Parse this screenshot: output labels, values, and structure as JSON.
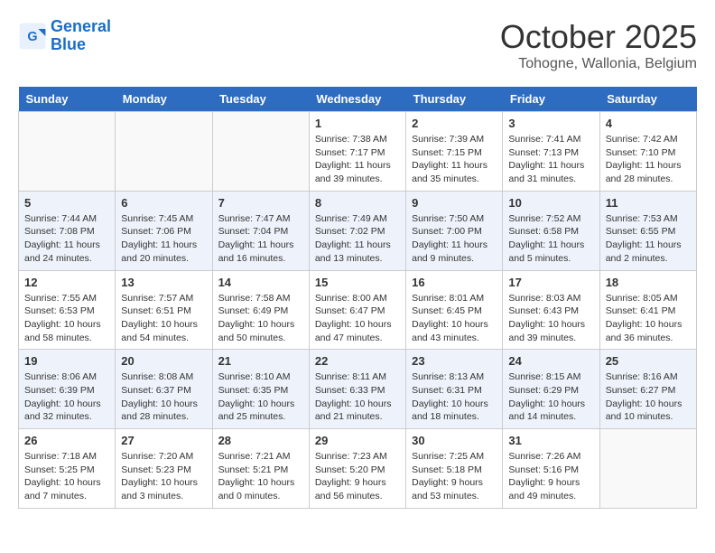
{
  "header": {
    "logo_line1": "General",
    "logo_line2": "Blue",
    "month_title": "October 2025",
    "location": "Tohogne, Wallonia, Belgium"
  },
  "weekdays": [
    "Sunday",
    "Monday",
    "Tuesday",
    "Wednesday",
    "Thursday",
    "Friday",
    "Saturday"
  ],
  "weeks": [
    [
      {
        "day": "",
        "info": ""
      },
      {
        "day": "",
        "info": ""
      },
      {
        "day": "",
        "info": ""
      },
      {
        "day": "1",
        "info": "Sunrise: 7:38 AM\nSunset: 7:17 PM\nDaylight: 11 hours\nand 39 minutes."
      },
      {
        "day": "2",
        "info": "Sunrise: 7:39 AM\nSunset: 7:15 PM\nDaylight: 11 hours\nand 35 minutes."
      },
      {
        "day": "3",
        "info": "Sunrise: 7:41 AM\nSunset: 7:13 PM\nDaylight: 11 hours\nand 31 minutes."
      },
      {
        "day": "4",
        "info": "Sunrise: 7:42 AM\nSunset: 7:10 PM\nDaylight: 11 hours\nand 28 minutes."
      }
    ],
    [
      {
        "day": "5",
        "info": "Sunrise: 7:44 AM\nSunset: 7:08 PM\nDaylight: 11 hours\nand 24 minutes."
      },
      {
        "day": "6",
        "info": "Sunrise: 7:45 AM\nSunset: 7:06 PM\nDaylight: 11 hours\nand 20 minutes."
      },
      {
        "day": "7",
        "info": "Sunrise: 7:47 AM\nSunset: 7:04 PM\nDaylight: 11 hours\nand 16 minutes."
      },
      {
        "day": "8",
        "info": "Sunrise: 7:49 AM\nSunset: 7:02 PM\nDaylight: 11 hours\nand 13 minutes."
      },
      {
        "day": "9",
        "info": "Sunrise: 7:50 AM\nSunset: 7:00 PM\nDaylight: 11 hours\nand 9 minutes."
      },
      {
        "day": "10",
        "info": "Sunrise: 7:52 AM\nSunset: 6:58 PM\nDaylight: 11 hours\nand 5 minutes."
      },
      {
        "day": "11",
        "info": "Sunrise: 7:53 AM\nSunset: 6:55 PM\nDaylight: 11 hours\nand 2 minutes."
      }
    ],
    [
      {
        "day": "12",
        "info": "Sunrise: 7:55 AM\nSunset: 6:53 PM\nDaylight: 10 hours\nand 58 minutes."
      },
      {
        "day": "13",
        "info": "Sunrise: 7:57 AM\nSunset: 6:51 PM\nDaylight: 10 hours\nand 54 minutes."
      },
      {
        "day": "14",
        "info": "Sunrise: 7:58 AM\nSunset: 6:49 PM\nDaylight: 10 hours\nand 50 minutes."
      },
      {
        "day": "15",
        "info": "Sunrise: 8:00 AM\nSunset: 6:47 PM\nDaylight: 10 hours\nand 47 minutes."
      },
      {
        "day": "16",
        "info": "Sunrise: 8:01 AM\nSunset: 6:45 PM\nDaylight: 10 hours\nand 43 minutes."
      },
      {
        "day": "17",
        "info": "Sunrise: 8:03 AM\nSunset: 6:43 PM\nDaylight: 10 hours\nand 39 minutes."
      },
      {
        "day": "18",
        "info": "Sunrise: 8:05 AM\nSunset: 6:41 PM\nDaylight: 10 hours\nand 36 minutes."
      }
    ],
    [
      {
        "day": "19",
        "info": "Sunrise: 8:06 AM\nSunset: 6:39 PM\nDaylight: 10 hours\nand 32 minutes."
      },
      {
        "day": "20",
        "info": "Sunrise: 8:08 AM\nSunset: 6:37 PM\nDaylight: 10 hours\nand 28 minutes."
      },
      {
        "day": "21",
        "info": "Sunrise: 8:10 AM\nSunset: 6:35 PM\nDaylight: 10 hours\nand 25 minutes."
      },
      {
        "day": "22",
        "info": "Sunrise: 8:11 AM\nSunset: 6:33 PM\nDaylight: 10 hours\nand 21 minutes."
      },
      {
        "day": "23",
        "info": "Sunrise: 8:13 AM\nSunset: 6:31 PM\nDaylight: 10 hours\nand 18 minutes."
      },
      {
        "day": "24",
        "info": "Sunrise: 8:15 AM\nSunset: 6:29 PM\nDaylight: 10 hours\nand 14 minutes."
      },
      {
        "day": "25",
        "info": "Sunrise: 8:16 AM\nSunset: 6:27 PM\nDaylight: 10 hours\nand 10 minutes."
      }
    ],
    [
      {
        "day": "26",
        "info": "Sunrise: 7:18 AM\nSunset: 5:25 PM\nDaylight: 10 hours\nand 7 minutes."
      },
      {
        "day": "27",
        "info": "Sunrise: 7:20 AM\nSunset: 5:23 PM\nDaylight: 10 hours\nand 3 minutes."
      },
      {
        "day": "28",
        "info": "Sunrise: 7:21 AM\nSunset: 5:21 PM\nDaylight: 10 hours\nand 0 minutes."
      },
      {
        "day": "29",
        "info": "Sunrise: 7:23 AM\nSunset: 5:20 PM\nDaylight: 9 hours\nand 56 minutes."
      },
      {
        "day": "30",
        "info": "Sunrise: 7:25 AM\nSunset: 5:18 PM\nDaylight: 9 hours\nand 53 minutes."
      },
      {
        "day": "31",
        "info": "Sunrise: 7:26 AM\nSunset: 5:16 PM\nDaylight: 9 hours\nand 49 minutes."
      },
      {
        "day": "",
        "info": ""
      }
    ]
  ]
}
